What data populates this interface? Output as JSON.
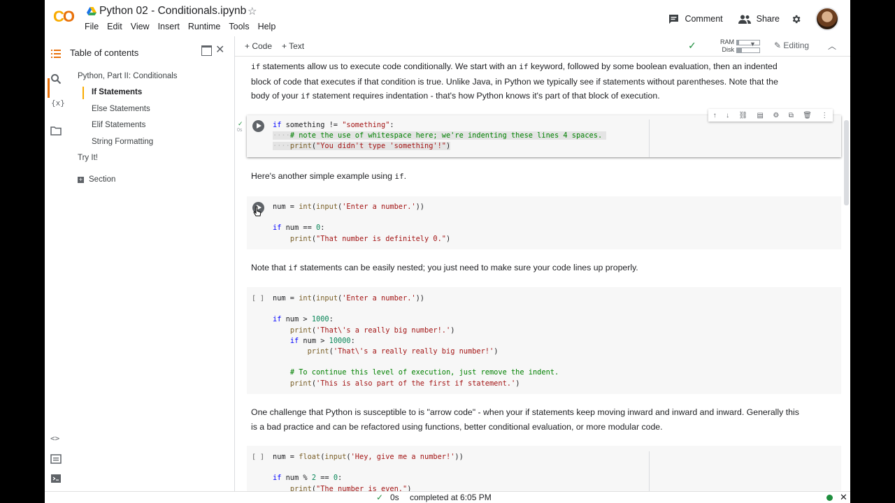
{
  "header": {
    "title": "Python 02 - Conditionals.ipynb",
    "menu": [
      "File",
      "Edit",
      "View",
      "Insert",
      "Runtime",
      "Tools",
      "Help"
    ],
    "comment_label": "Comment",
    "share_label": "Share"
  },
  "sidebar": {
    "title": "Table of contents",
    "items": [
      {
        "label": "Python, Part II: Conditionals"
      },
      {
        "label": "If Statements"
      },
      {
        "label": "Else Statements"
      },
      {
        "label": "Elif Statements"
      },
      {
        "label": "String Formatting"
      },
      {
        "label": "Try It!"
      },
      {
        "label": "Section"
      }
    ]
  },
  "toolbar": {
    "add_code": "Code",
    "add_text": "Text",
    "ram": "RAM",
    "disk": "Disk",
    "mode": "Editing"
  },
  "content": {
    "p1": "statements allow us to execute code conditionally. We start with an",
    "p1_kw1": "if",
    "p1_kw2": "if",
    "p1_b": "keyword, followed by some boolean evaluation, then an indented",
    "p1_line2": "block of code that executes if that condition is true. Unlike Java, in Python we typically see if statements without parentheses. Note that the",
    "p1_line3a": "body of your",
    "p1_kw3": "if",
    "p1_line3b": "statement requires indentation - that's how Python knows it's part of that block of execution.",
    "p2a": "Here's another simple example using",
    "p2_kw": "if",
    "p2b": ".",
    "p3a": "Note that",
    "p3_kw": "if",
    "p3b": "statements can be easily nested; you just need to make sure your code lines up properly.",
    "p4_line1": "One challenge that Python is susceptible to is \"arrow code\" - when your if statements keep moving inward and inward and inward. Generally this",
    "p4_line2": "is a bad practice and can be refactored using functions, better conditional evaluation, or more modular code.",
    "cell1_time": "0s",
    "empty_bracket": "[ ]"
  },
  "status": {
    "time": "0s",
    "message": "completed at 6:05 PM"
  }
}
